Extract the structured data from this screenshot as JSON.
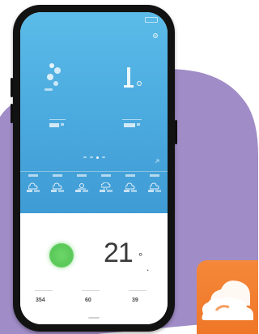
{
  "colors": {
    "blob": "#a08cc6",
    "sky_top": "#5bbbe8",
    "sky_bottom": "#3f9bd4",
    "aqi": "#59c958",
    "app_icon": "#ef7627"
  },
  "weather": {
    "main_temperature": "21",
    "main_unit": "°",
    "main_unit_suffix": ".",
    "stats": [
      "354",
      "60",
      "39"
    ]
  },
  "icons": {
    "wind": "wind-icon",
    "settings": "gear-icon",
    "forecast": "cloud-icon",
    "app": "cloud-sun-icon"
  }
}
